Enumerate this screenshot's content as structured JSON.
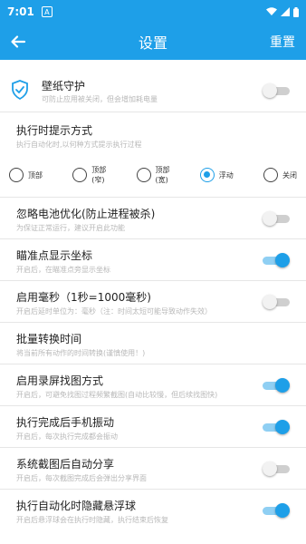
{
  "status_bar": {
    "time": "7:01",
    "notification_icon": "A",
    "icons": [
      "wifi-icon",
      "signal-icon",
      "battery-icon"
    ]
  },
  "app_bar": {
    "title": "设置",
    "reset_label": "重置"
  },
  "colors": {
    "primary": "#1e9fe8",
    "toggle_on_track": "#8fcff3",
    "toggle_off_track": "#cfcfcf"
  },
  "settings": [
    {
      "title": "壁纸守护",
      "subtitle": "可防止应用被关闭，但会增加耗电量",
      "enabled": false
    },
    {
      "title": "执行时提示方式",
      "subtitle": "执行自动化时,以何种方式提示执行过程",
      "options": [
        "顶部",
        "顶部\n(窄)",
        "顶部\n(宽)",
        "浮动",
        "关闭"
      ],
      "selected": "浮动"
    },
    {
      "title": "忽略电池优化(防止进程被杀)",
      "subtitle": "为保证正常运行，建议开启此功能",
      "enabled": false
    },
    {
      "title": "瞄准点显示坐标",
      "subtitle": "开启后，在瞄准点旁显示坐标",
      "enabled": true
    },
    {
      "title": "启用毫秒（1秒=1000毫秒)",
      "subtitle": "开启后延时单位为：毫秒（注：时间太短可能导致动作失效）",
      "enabled": false
    },
    {
      "title": "批量转换时间",
      "subtitle": "将当前所有动作的时间转换(谨慎使用！)"
    },
    {
      "title": "启用录屏找图方式",
      "subtitle": "开启后，可避免找图过程频繁截图(自动比较慢，但后续找图快)",
      "enabled": true
    },
    {
      "title": "执行完成后手机振动",
      "subtitle": "开启后，每次执行完成都会振动",
      "enabled": true
    },
    {
      "title": "系统截图后自动分享",
      "subtitle": "开启后，每次截图完成后会弹出分享界面",
      "enabled": false
    },
    {
      "title": "执行自动化时隐藏悬浮球",
      "subtitle": "开启后悬浮球会在执行时隐藏，执行结束后恢复",
      "enabled": true
    }
  ]
}
